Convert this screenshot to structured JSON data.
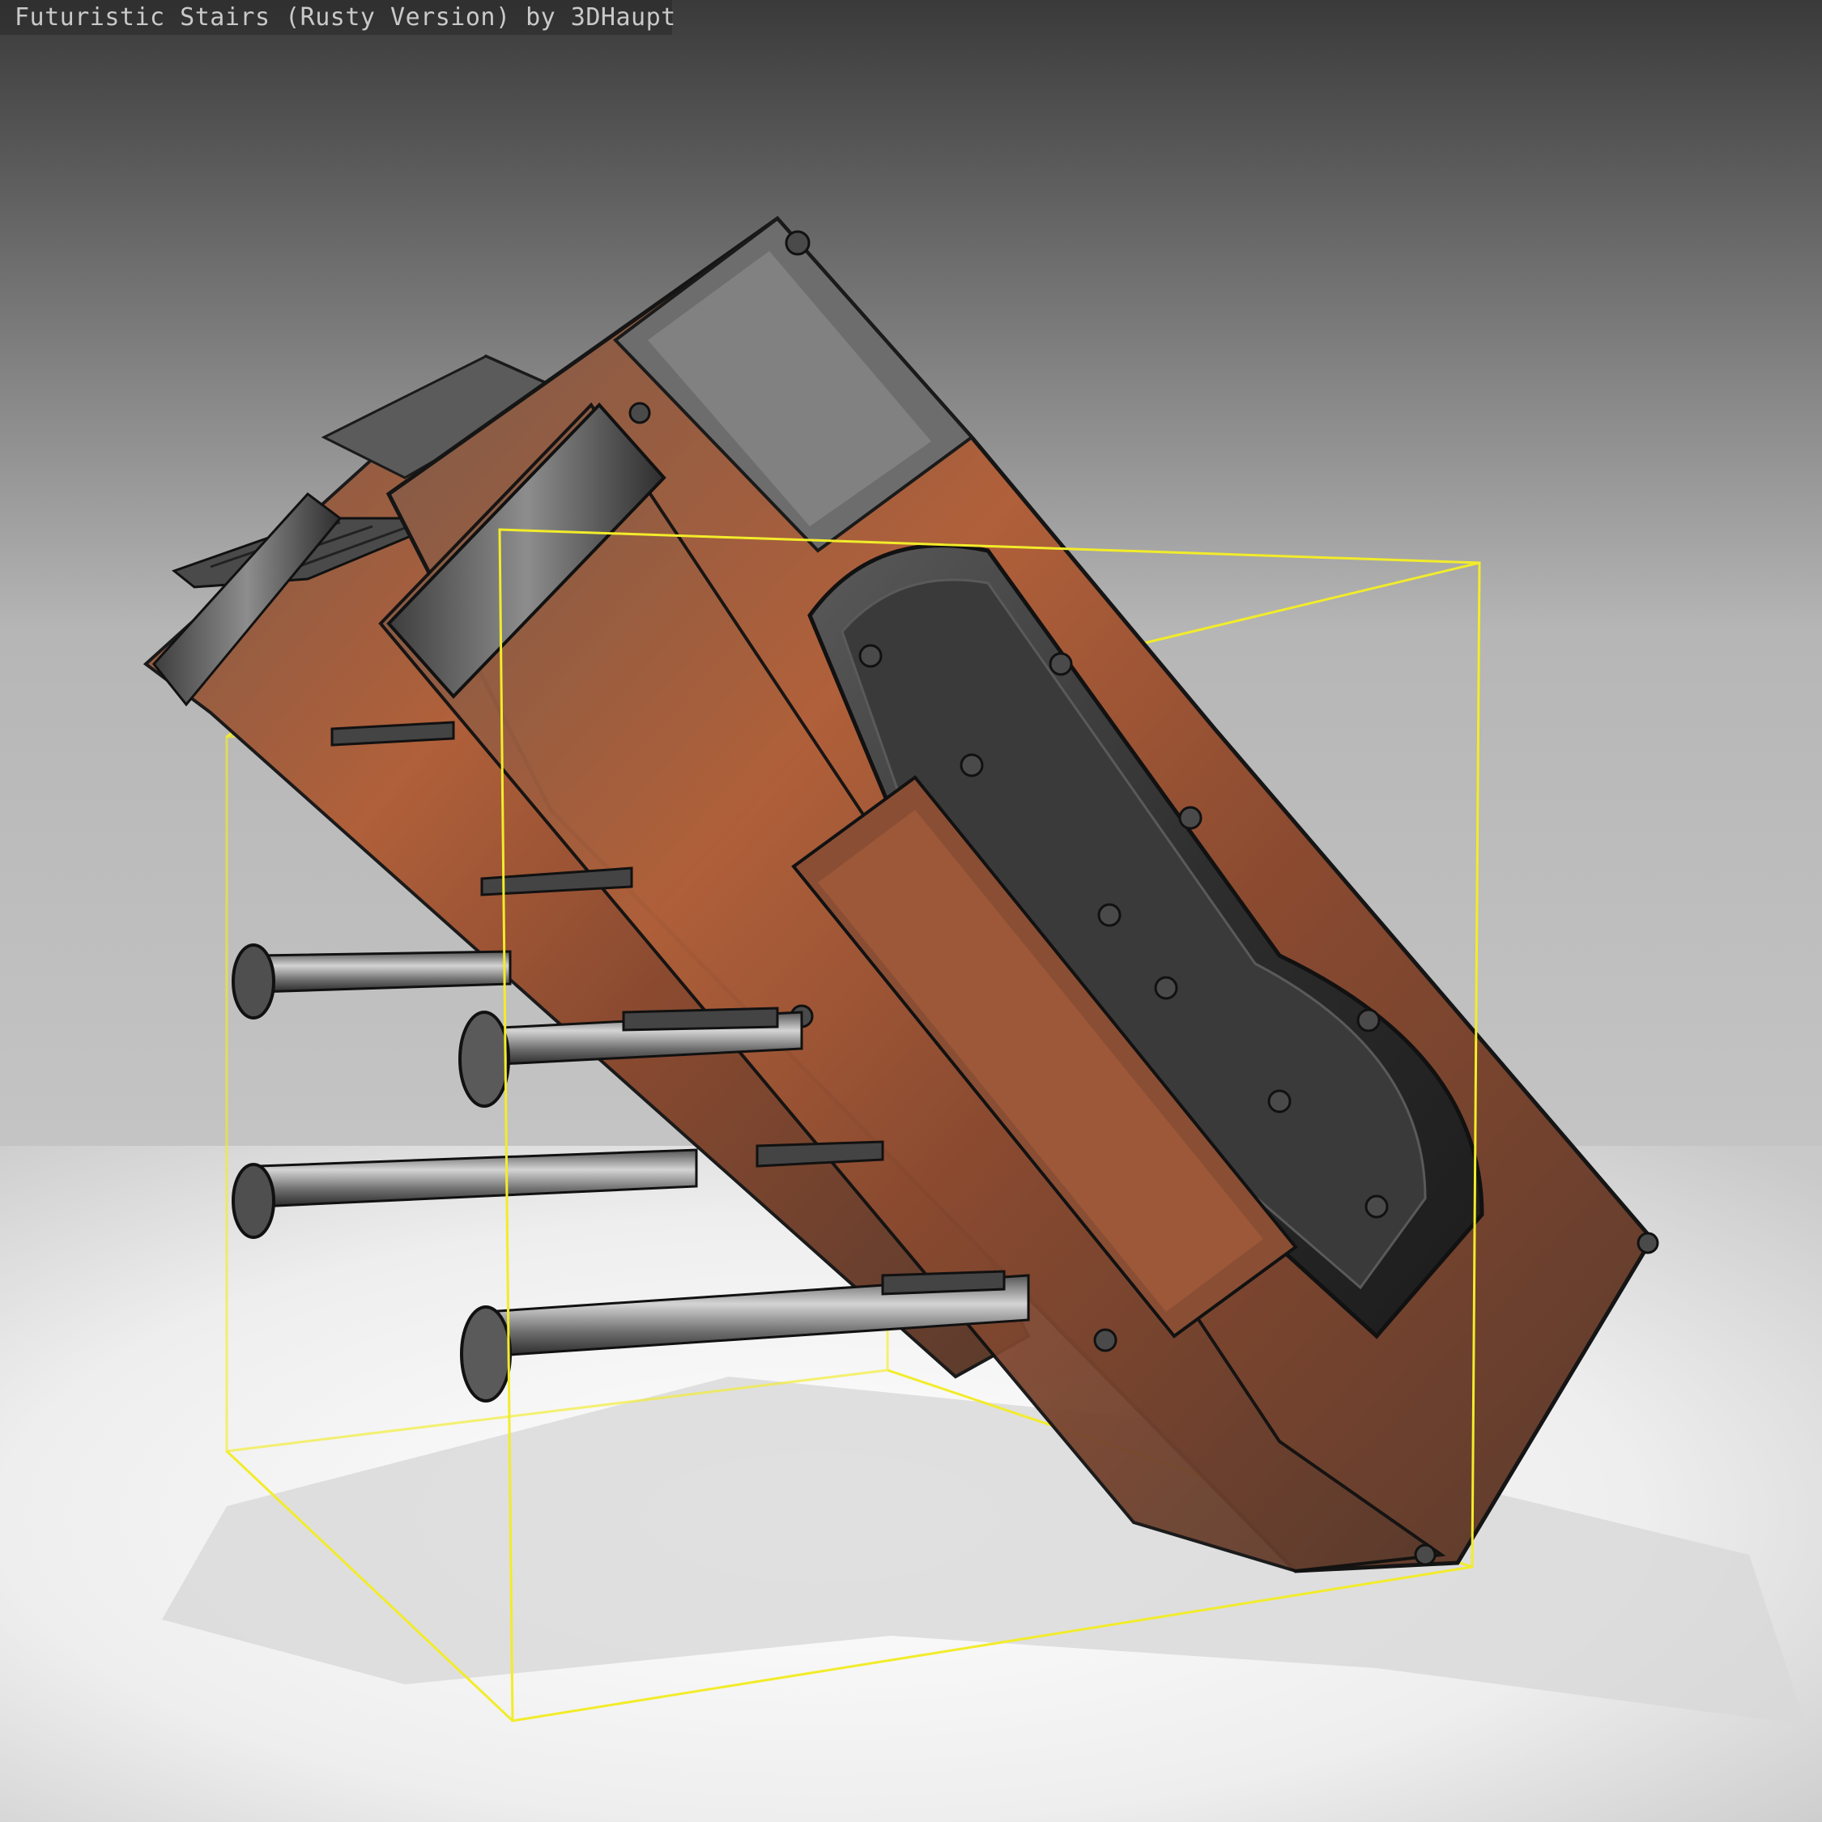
{
  "viewer": {
    "title": "Futuristic Stairs (Rusty Version) by 3DHaupt",
    "bounding_box_color": "#f2ec2a",
    "background_top_color": "#3a3a3a",
    "background_bottom_color": "#b4b4b4",
    "floor_color": "#f2f2f2",
    "model_icon": "rusty-stairs-model"
  }
}
